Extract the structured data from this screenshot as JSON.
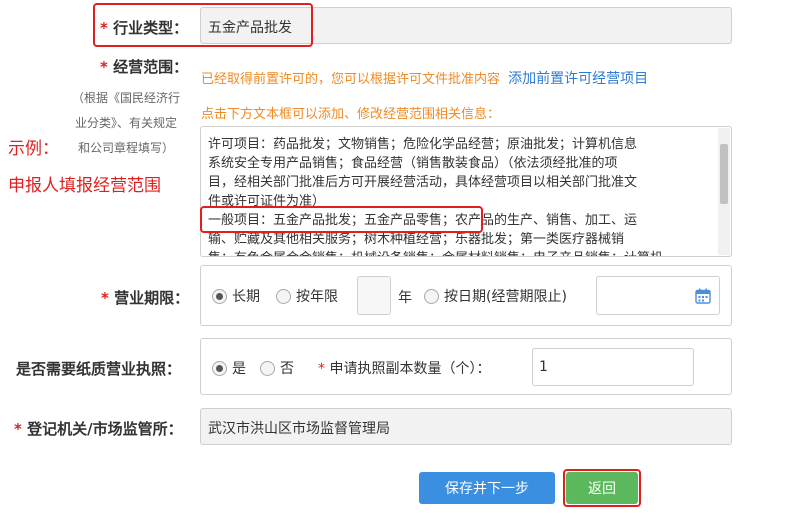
{
  "industry": {
    "required_mark": "*",
    "label": "行业类型：",
    "value": "五金产品批发"
  },
  "scope": {
    "required_mark": "*",
    "label": "经营范围：",
    "note_line1": "（根据《国民经济行",
    "note_line2": "业分类》、有关规定",
    "note_line3": "和公司章程填写）",
    "hint_prefix": "已经取得前置许可的，您可以根据许可文件批准内容",
    "hint_link": "添加前置许可经营项目",
    "hint_click": "点击下方文本框可以添加、修改经营范围相关信息：",
    "example_label": "示例：",
    "example_desc": "申报人填报经营范围",
    "text_lines": [
      "许可项目：药品批发；文物销售；危险化学品经营；原油批发；计算机信息",
      "系统安全专用产品销售；食品经营（销售散装食品）（依法须经批准的项",
      "目，经相关部门批准后方可开展经营活动，具体经营项目以相关部门批准文",
      "件或许可证件为准）"
    ],
    "general_highlight": "一般项目：五金产品批发；五金产品零售",
    "general_rest": "；农产品的生产、销售、加工、运",
    "text_line6": "输、贮藏及其他相关服务；树木种植经营；乐器批发；第一类医疗器械销",
    "text_line7": "售；有色金属合金销售；机械设备销售；金属材料销售；电子产品销售；计算机"
  },
  "term": {
    "required_mark": "*",
    "label": "营业期限：",
    "option_long": "长期",
    "option_year": "按年限",
    "year_unit": "年",
    "option_date": "按日期(经营期限止)",
    "year_value": "",
    "date_value": ""
  },
  "paper": {
    "label": "是否需要纸质营业执照：",
    "option_yes": "是",
    "option_no": "否",
    "copies_required_mark": "*",
    "copies_label": "申请执照副本数量（个）：",
    "copies_value": "1"
  },
  "authority": {
    "required_mark": "*",
    "label": "登记机关/市场监管所：",
    "value": "武汉市洪山区市场监督管理局"
  },
  "buttons": {
    "save_next": "保存并下一步",
    "back": "返回"
  },
  "colors": {
    "required": "#e02020",
    "hint": "#f08a24",
    "link": "#2c7ad6",
    "primary_button": "#3b8fe0",
    "back_button": "#5cb85c"
  }
}
